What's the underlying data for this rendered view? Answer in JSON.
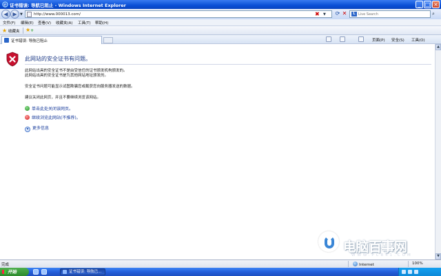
{
  "window": {
    "title": "证书错误: 导航已阻止 - Windows Internet Explorer",
    "minimize": "_",
    "maximize": "□",
    "close": "×"
  },
  "address_bar": {
    "url": "http://www.000013.com/",
    "search_placeholder": "Live Search"
  },
  "menu": {
    "items": [
      "文件(F)",
      "编辑(E)",
      "查看(V)",
      "收藏夹(A)",
      "工具(T)",
      "帮助(H)"
    ]
  },
  "favorites": {
    "label": "收藏夹"
  },
  "tab": {
    "label": "证书错误: 导航已阻止"
  },
  "command_bar": {
    "page": "页面(P)",
    "safety": "安全(S)",
    "tools": "工具(O)"
  },
  "content": {
    "heading": "此网站的安全证书有问题。",
    "para1_line1": "此网站出具的安全证书不是由受信任的证书颁发机构颁发的。",
    "para1_line2": "此网站出具的安全证书是为其他网站地址颁发的。",
    "para2": "安全证书问题可能显示试图欺骗您或截获您向服务器发送的数据。",
    "para3": "建议关闭此网页，并且不要继续浏览该网站。",
    "link_close": "单击此处关闭该网页。",
    "link_continue": "继续浏览此网站(不推荐)。",
    "more_info": "更多信息"
  },
  "status_bar": {
    "status": "完成",
    "zone": "Internet",
    "zoom": "100%"
  },
  "taskbar": {
    "start": "开始",
    "task": "证书错误: 导航已..."
  },
  "watermark": {
    "text": "电脑百事网",
    "url": "WWW.PC841.COM"
  },
  "colors": {
    "titlebar": "#0a4fd6",
    "link": "#1a3d9c",
    "heading": "#1f3c88",
    "shield_red": "#c8102e"
  },
  "icons": [
    "ie-icon",
    "back-icon",
    "forward-icon",
    "refresh-icon",
    "stop-icon",
    "live-search-icon",
    "favorites-star-icon",
    "add-favorite-icon",
    "home-icon",
    "feeds-icon",
    "print-icon",
    "shield-error-icon",
    "green-arrow-icon",
    "red-shield-icon",
    "more-info-icon",
    "globe-icon"
  ]
}
